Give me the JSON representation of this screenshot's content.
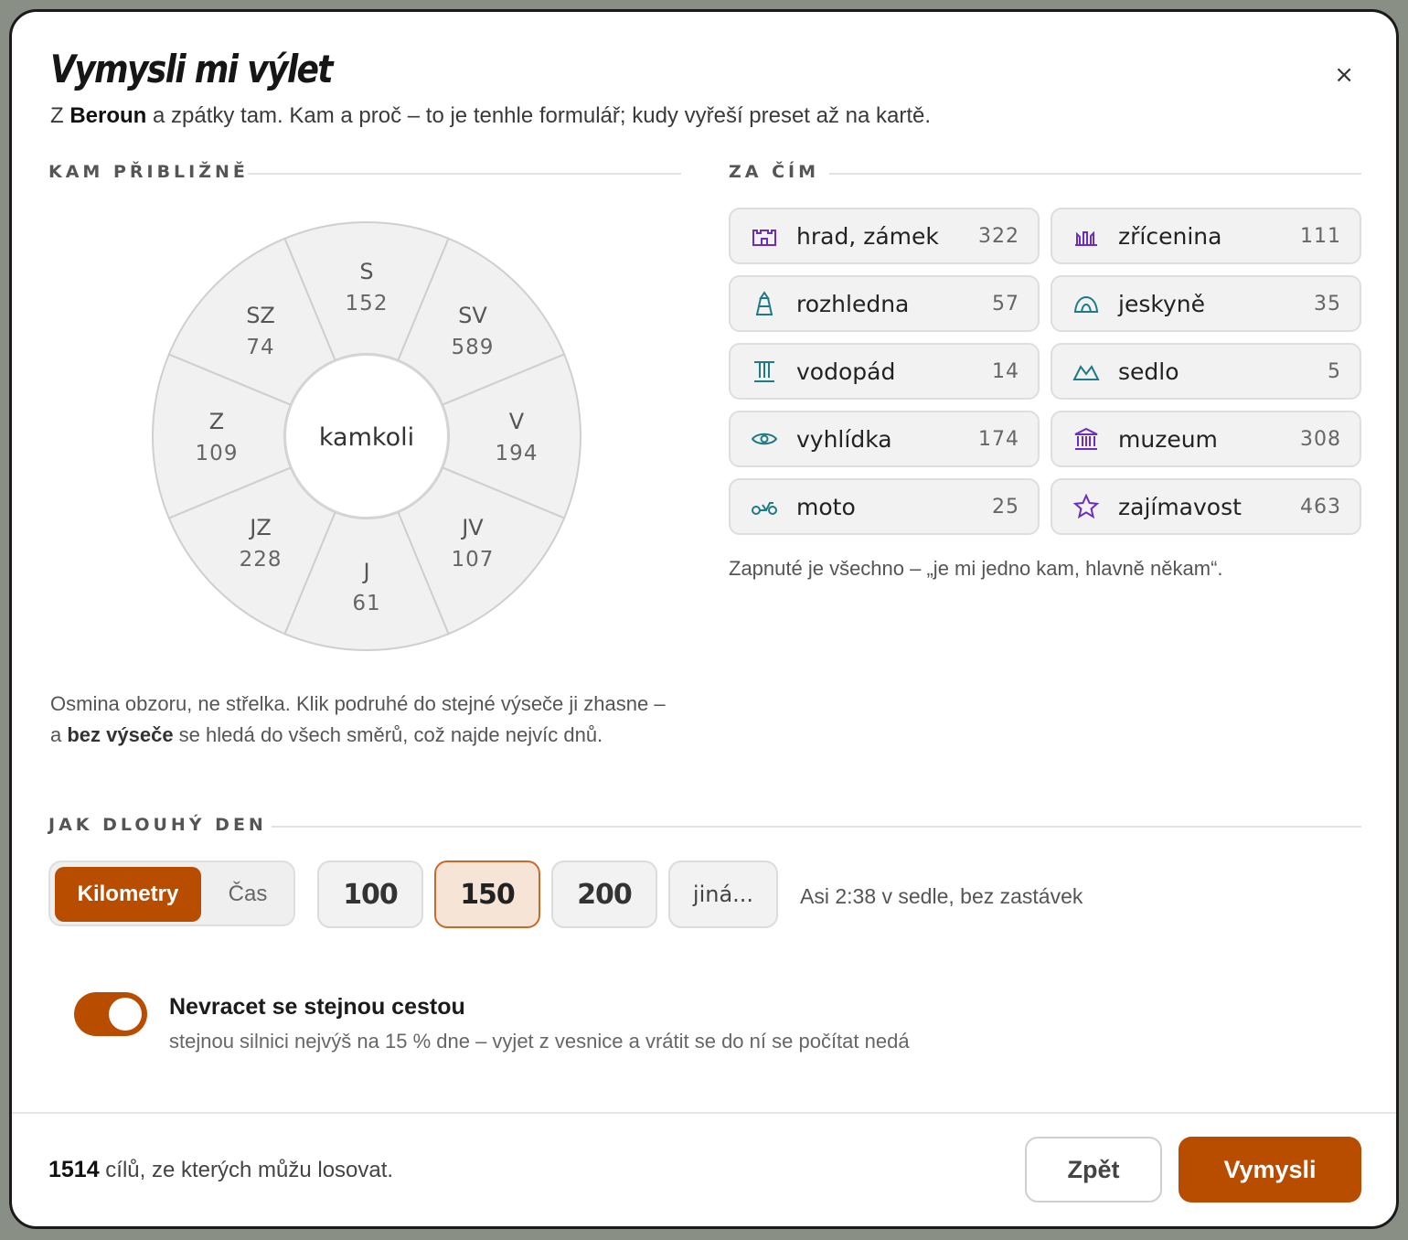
{
  "dialog": {
    "title": "Vymysli mi výlet",
    "close_symbol": "×",
    "subtitle_prefix": "Z ",
    "subtitle_place": "Beroun",
    "subtitle_rest": " a zpátky tam. Kam a proč – to je tenhle formulář; kudy vyřeší preset až na kartě."
  },
  "direction": {
    "section_label": "KAM PŘIBLIŽNĚ",
    "center_label": "kamkoli",
    "sectors": [
      {
        "label": "S",
        "count": "152"
      },
      {
        "label": "SV",
        "count": "589"
      },
      {
        "label": "V",
        "count": "194"
      },
      {
        "label": "JV",
        "count": "107"
      },
      {
        "label": "J",
        "count": "61"
      },
      {
        "label": "JZ",
        "count": "228"
      },
      {
        "label": "Z",
        "count": "109"
      },
      {
        "label": "SZ",
        "count": "74"
      }
    ],
    "hint_part1": "Osmina obzoru, ne střelka. Klik podruhé do stejné výseče ji zhasne – a ",
    "hint_bold": "bez výseče",
    "hint_part2": " se hledá do všech směrů, což najde nejvíc dnů."
  },
  "categories": {
    "section_label": "ZA ČÍM",
    "items": [
      {
        "label": "hrad, zámek",
        "count": "322",
        "icon": "castle-icon"
      },
      {
        "label": "zřícenina",
        "count": "111",
        "icon": "ruin-icon"
      },
      {
        "label": "rozhledna",
        "count": "57",
        "icon": "lookout-tower-icon"
      },
      {
        "label": "jeskyně",
        "count": "35",
        "icon": "cave-icon"
      },
      {
        "label": "vodopád",
        "count": "14",
        "icon": "waterfall-icon"
      },
      {
        "label": "sedlo",
        "count": "5",
        "icon": "mountain-pass-icon"
      },
      {
        "label": "vyhlídka",
        "count": "174",
        "icon": "eye-icon"
      },
      {
        "label": "muzeum",
        "count": "308",
        "icon": "museum-icon"
      },
      {
        "label": "moto",
        "count": "25",
        "icon": "motorcycle-icon"
      },
      {
        "label": "zajímavost",
        "count": "463",
        "icon": "star-icon"
      }
    ],
    "note": "Zapnuté je všechno – „je mi jedno kam, hlavně někam“."
  },
  "length": {
    "section_label": "JAK DLOUHÝ DEN",
    "mode_km": "Kilometry",
    "mode_time": "Čas",
    "options": [
      "100",
      "150",
      "200"
    ],
    "selected": "150",
    "other_label": "jiná...",
    "note": "Asi 2:38 v sedle, bez zastávek"
  },
  "no_return": {
    "title": "Nevracet se stejnou cestou",
    "description": "stejnou silnici nejvýš na 15 % dne – vyjet z vesnice a vrátit se do ní se počítat nedá",
    "enabled": true
  },
  "footer": {
    "count": "1514",
    "count_text": " cílů, ze kterých můžu losovat.",
    "back_label": "Zpět",
    "submit_label": "Vymysli"
  },
  "colors": {
    "accent": "#b84d00",
    "icon_purple": "#6a2fc0",
    "icon_teal": "#1f7a86"
  }
}
